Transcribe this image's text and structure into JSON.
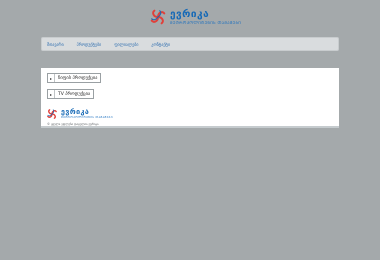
{
  "brand": {
    "name": "ევრიკა",
    "subtitle": "ᲛᲔᲢᲠᲝᲞᲝᲚᲘᲢᲔᲜᲘᲡ ᲗᲐᲛᲐᲨᲔᲑᲘ",
    "colors": {
      "primary": "#1669b6",
      "accent": "#e0403a"
    }
  },
  "nav": {
    "items": [
      {
        "label": "მთავარი"
      },
      {
        "label": "პროდუქტები"
      },
      {
        "label": "ფილიალები"
      },
      {
        "label": "კონტაქტი"
      }
    ]
  },
  "categories": [
    {
      "label": "ჩიფის პროდუქცია",
      "icon": "chevron-right-icon"
    },
    {
      "label": "TV პროდუქცია",
      "icon": "chevron-right-icon"
    }
  ],
  "footer": {
    "brand_name": "ევრიკა",
    "brand_subtitle": "ᲛᲔᲢᲠᲝᲞᲝᲚᲘᲢᲔᲜᲘᲡ ᲗᲐᲛᲐᲨᲔᲑᲘ",
    "text": "© ყველა უფლება დაცულია ევრიკა"
  }
}
